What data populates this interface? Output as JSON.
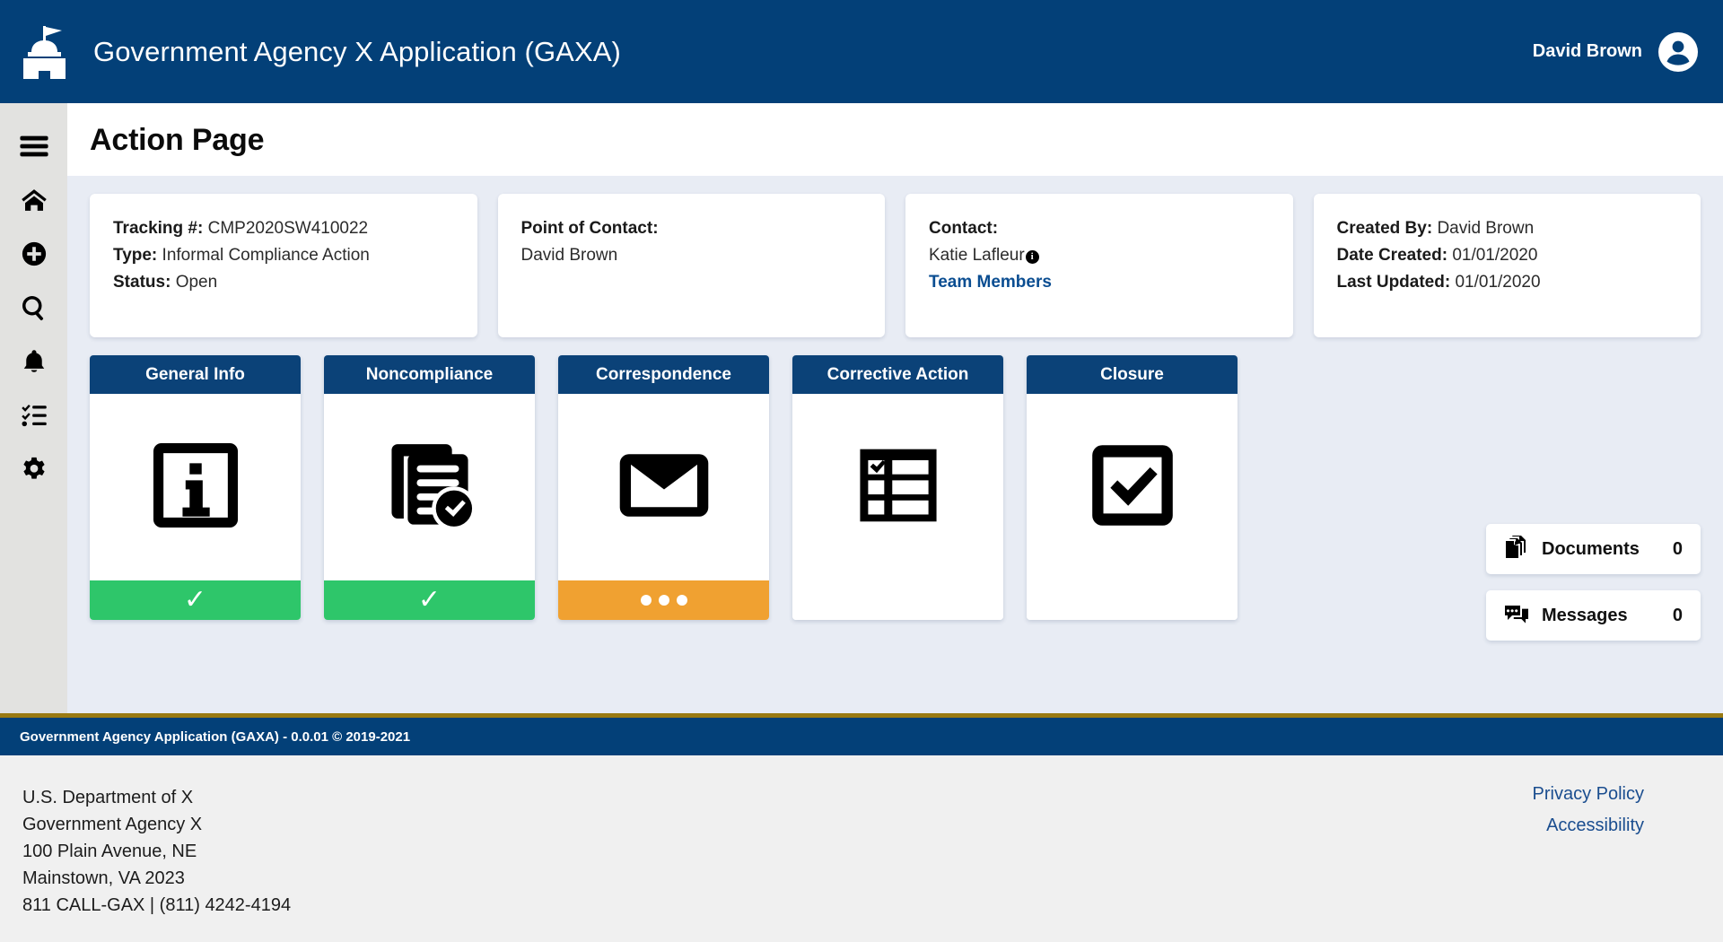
{
  "header": {
    "brand_icon": "capitol-building-icon",
    "title": "Government Agency X Application (GAXA)",
    "user_name": "David Brown",
    "avatar_icon": "user-avatar-icon",
    "background_color": "#034078"
  },
  "sidebar": {
    "items": [
      {
        "name": "menu",
        "icon": "hamburger-menu-icon"
      },
      {
        "name": "home",
        "icon": "home-icon"
      },
      {
        "name": "create",
        "icon": "plus-circle-icon"
      },
      {
        "name": "search",
        "icon": "search-icon"
      },
      {
        "name": "notifications",
        "icon": "bell-icon"
      },
      {
        "name": "tasks",
        "icon": "checklist-icon"
      },
      {
        "name": "settings",
        "icon": "gear-icon"
      }
    ]
  },
  "page": {
    "title": "Action Page"
  },
  "summary_cards": [
    {
      "name": "tracking-card",
      "rows": [
        {
          "label": "Tracking #:",
          "value": "CMP2020SW410022"
        },
        {
          "label": "Type:",
          "value": "Informal Compliance Action"
        },
        {
          "label": "Status:",
          "value": "Open"
        }
      ]
    },
    {
      "name": "point-of-contact-card",
      "rows": [
        {
          "label": "Point of Contact:",
          "value": ""
        },
        {
          "label": "",
          "value": "David Brown"
        }
      ]
    },
    {
      "name": "contact-card",
      "rows": [
        {
          "label": "Contact:",
          "value": ""
        },
        {
          "label": "",
          "value": "Katie Lafleur"
        }
      ],
      "info_icon": "info-circle-icon",
      "link": "Team Members"
    },
    {
      "name": "metadata-card",
      "rows": [
        {
          "label": "Created By:",
          "value": "David Brown"
        },
        {
          "label": "Date Created:",
          "value": "01/01/2020"
        },
        {
          "label": "Last Updated:",
          "value": "01/01/2020"
        }
      ]
    }
  ],
  "process_cards": [
    {
      "title": "General Info",
      "icon": "info-square-icon",
      "status": "complete",
      "status_glyph": "✓",
      "status_color": "#2ec66a"
    },
    {
      "title": "Noncompliance",
      "icon": "documents-check-icon",
      "status": "complete",
      "status_glyph": "✓",
      "status_color": "#2ec66a"
    },
    {
      "title": "Correspondence",
      "icon": "envelope-icon",
      "status": "in-progress",
      "status_glyph": "•••",
      "status_color": "#f0a131"
    },
    {
      "title": "Corrective Action",
      "icon": "task-list-icon",
      "status": "not-started",
      "status_glyph": "",
      "status_color": "#ffffff"
    },
    {
      "title": "Closure",
      "icon": "checkbox-checked-icon",
      "status": "not-started",
      "status_glyph": "",
      "status_color": "#ffffff"
    }
  ],
  "widgets": [
    {
      "label": "Documents",
      "count": "0",
      "icon": "documents-stack-icon"
    },
    {
      "label": "Messages",
      "count": "0",
      "icon": "chat-bubbles-icon"
    }
  ],
  "footer": {
    "version_text": "Government Agency Application (GAXA) - 0.0.01 © 2019-2021",
    "address": [
      "U.S. Department of X",
      "Government Agency X",
      "100 Plain Avenue, NE",
      "Mainstown, VA 2023",
      "811 CALL-GAX | (811) 4242-4194"
    ],
    "links": [
      "Privacy Policy",
      "Accessibility"
    ]
  }
}
